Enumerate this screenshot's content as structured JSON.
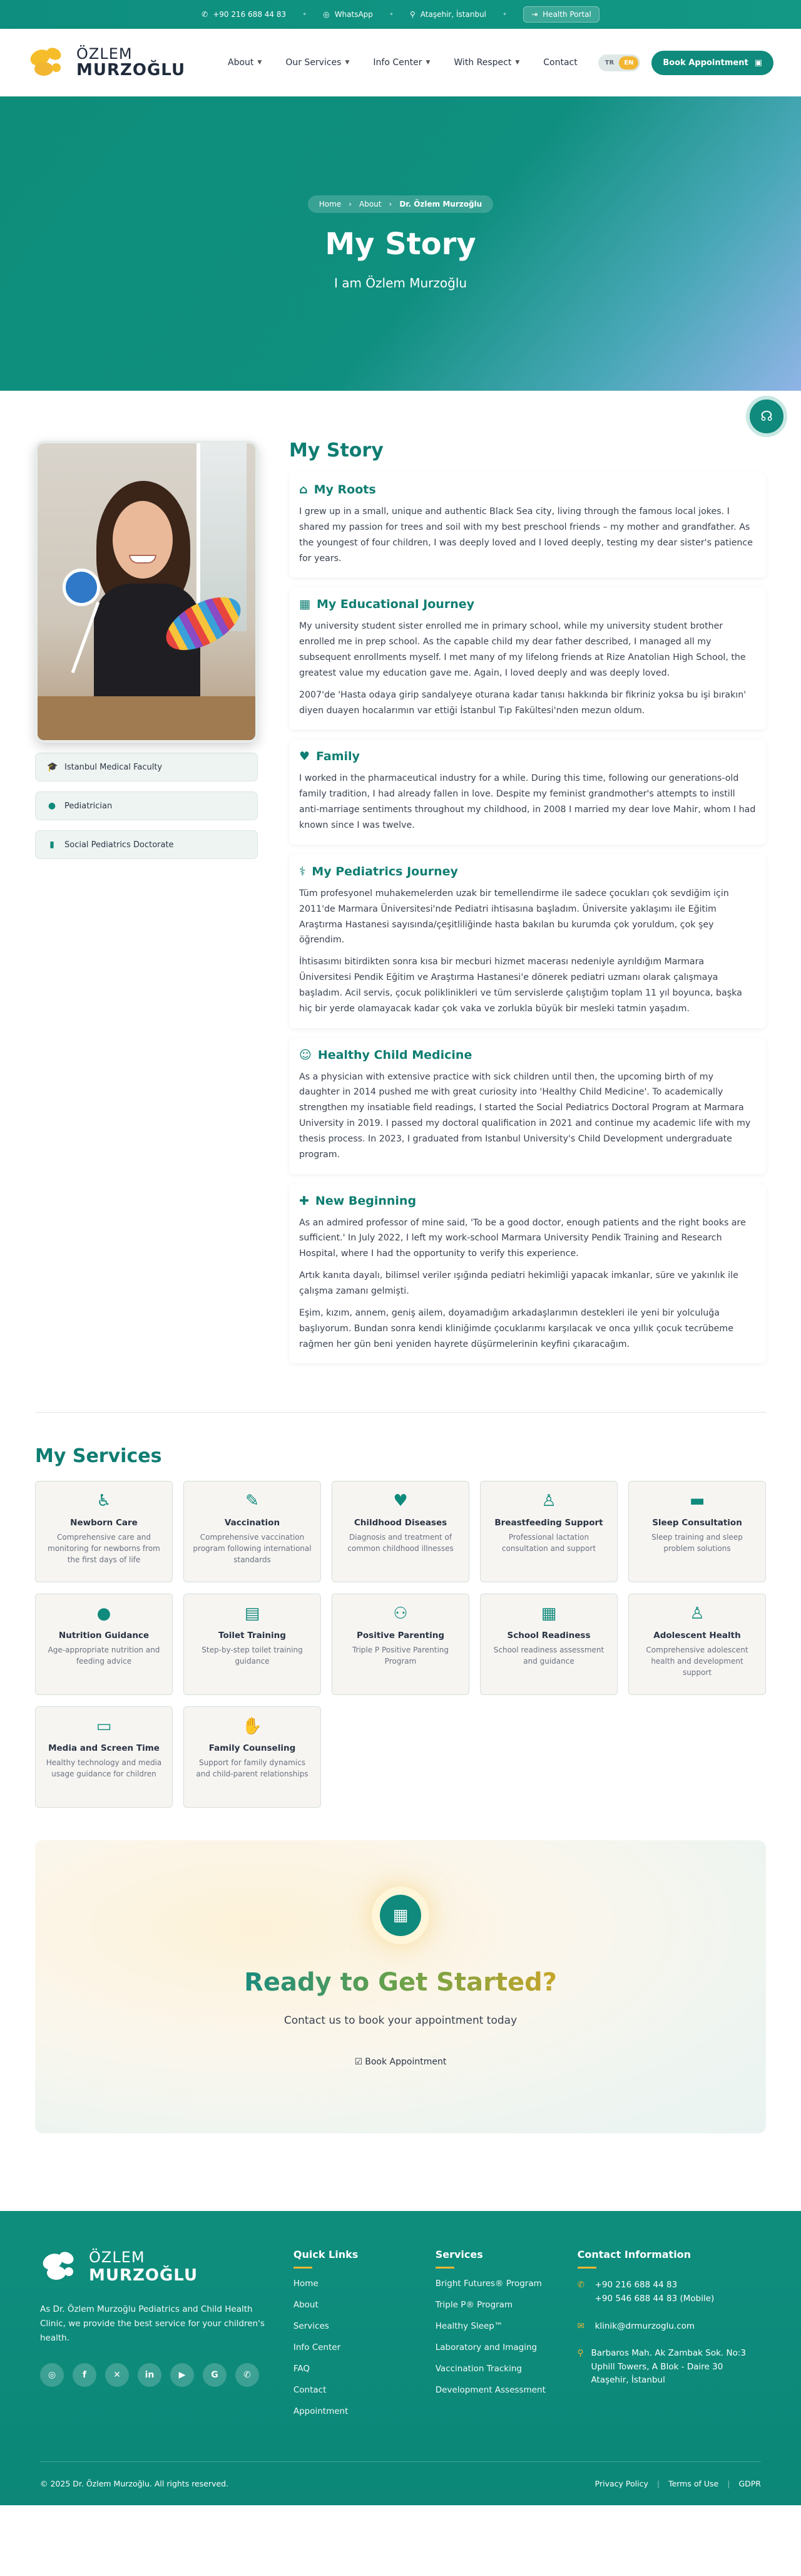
{
  "topbar": {
    "phone": "+90 216 688 44 83",
    "whatsapp": "WhatsApp",
    "location": "Ataşehir, İstanbul",
    "portal": "Health Portal"
  },
  "header": {
    "logo_line1": "ÖZLEM",
    "logo_line2": "MURZOĞLU",
    "nav": [
      {
        "label": "About"
      },
      {
        "label": "Our Services"
      },
      {
        "label": "Info Center"
      },
      {
        "label": "With Respect"
      },
      {
        "label": "Contact"
      }
    ],
    "lang_tr": "TR",
    "lang_en": "EN",
    "book": "Book Appointment"
  },
  "hero": {
    "crumbs": [
      "Home",
      "About",
      "Dr. Özlem Murzoğlu"
    ],
    "title": "My Story",
    "subtitle": "I am Özlem Murzoğlu"
  },
  "tags": [
    {
      "label": "Istanbul Medical Faculty",
      "icon": "graduation-cap-icon"
    },
    {
      "label": "Pediatrician",
      "icon": "circle-icon"
    },
    {
      "label": "Social Pediatrics Doctorate",
      "icon": "book-icon"
    }
  ],
  "story": {
    "title": "My Story",
    "sections": [
      {
        "icon": "house-icon",
        "title": "My Roots",
        "paragraphs": [
          "I grew up in a small, unique and authentic Black Sea city, living through the famous local jokes. I shared my passion for trees and soil with my best preschool friends – my mother and grandfather. As the youngest of four children, I was deeply loved and I loved deeply, testing my dear sister's patience for years."
        ]
      },
      {
        "icon": "school-icon",
        "title": "My Educational Journey",
        "paragraphs": [
          "My university student sister enrolled me in primary school, while my university student brother enrolled me in prep school. As the capable child my dear father described, I managed all my subsequent enrollments myself. I met many of my lifelong friends at Rize Anatolian High School, the greatest value my education gave me. Again, I loved deeply and was deeply loved.",
          "2007'de 'Hasta odaya girip sandalyeye oturana kadar tanısı hakkında bir fikriniz yoksa bu işi bırakın' diyen duayen hocalarımın var ettiği İstanbul Tıp Fakültesi'nden mezun oldum."
        ]
      },
      {
        "icon": "heart-icon",
        "title": "Family",
        "paragraphs": [
          "I worked in the pharmaceutical industry for a while. During this time, following our generations-old family tradition, I had already fallen in love. Despite my feminist grandmother's attempts to instill anti-marriage sentiments throughout my childhood, in 2008 I married my dear love Mahir, whom I had known since I was twelve."
        ]
      },
      {
        "icon": "stethoscope-icon",
        "title": "My Pediatrics Journey",
        "paragraphs": [
          "Tüm profesyonel muhakemelerden uzak bir temellendirme ile sadece çocukları çok sevdiğim için 2011'de Marmara Üniversitesi'nde Pediatri ihtisasına başladım. Üniversite yaklaşımı ile Eğitim Araştırma Hastanesi sayısında/çeşitliliğinde hasta bakılan bu kurumda çok yoruldum, çok şey öğrendim.",
          "İhtisasımı bitirdikten sonra kısa bir mecburi hizmet macerası nedeniyle ayrıldığım Marmara Üniversitesi Pendik Eğitim ve Araştırma Hastanesi'e dönerek pediatri uzmanı olarak çalışmaya başladım. Acil servis, çocuk poliklinikleri ve tüm servislerde çalıştığım toplam 11 yıl boyunca, başka hiç bir yerde olamayacak kadar çok vaka ve zorlukla büyük bir mesleki tatmin yaşadım."
        ]
      },
      {
        "icon": "child-icon",
        "title": "Healthy Child Medicine",
        "paragraphs": [
          "As a physician with extensive practice with sick children until then, the upcoming birth of my daughter in 2014 pushed me with great curiosity into 'Healthy Child Medicine'. To academically strengthen my insatiable field readings, I started the Social Pediatrics Doctoral Program at Marmara University in 2019. I passed my doctoral qualification in 2021 and continue my academic life with my thesis process. In 2023, I graduated from Istanbul University's Child Development undergraduate program."
        ]
      },
      {
        "icon": "clinic-icon",
        "title": "New Beginning",
        "paragraphs": [
          "As an admired professor of mine said, 'To be a good doctor, enough patients and the right books are sufficient.' In July 2022, I left my work-school Marmara University Pendik Training and Research Hospital, where I had the opportunity to verify this experience.",
          "Artık kanıta dayalı, bilimsel veriler ışığında pediatri hekimliği yapacak imkanlar, süre ve yakınlık ile çalışma zamanı gelmişti.",
          "Eşim, kızım, annem, geniş ailem, doyamadığım arkadaşlarımın destekleri ile yeni bir yolculuğa başlıyorum. Bundan sonra kendi kliniğimde çocuklarımı karşılacak ve onca yıllık çocuk tecrübeme rağmen her gün beni yeniden hayrete düşürmelerinin keyfini çıkaracağım."
        ]
      }
    ]
  },
  "services": {
    "title": "My Services",
    "items": [
      {
        "title": "Newborn Care",
        "desc": "Comprehensive care and monitoring for newborns from the first days of life",
        "icon": "baby-carriage-icon"
      },
      {
        "title": "Vaccination",
        "desc": "Comprehensive vaccination program following international standards",
        "icon": "syringe-icon"
      },
      {
        "title": "Childhood Diseases",
        "desc": "Diagnosis and treatment of common childhood illnesses",
        "icon": "heartbeat-icon"
      },
      {
        "title": "Breastfeeding Support",
        "desc": "Professional lactation consultation and support",
        "icon": "person-icon"
      },
      {
        "title": "Sleep Consultation",
        "desc": "Sleep training and sleep problem solutions",
        "icon": "bed-icon"
      },
      {
        "title": "Nutrition Guidance",
        "desc": "Age-appropriate nutrition and feeding advice",
        "icon": "apple-icon"
      },
      {
        "title": "Toilet Training",
        "desc": "Step-by-step toilet training guidance",
        "icon": "toilet-icon"
      },
      {
        "title": "Positive Parenting",
        "desc": "Triple P Positive Parenting Program",
        "icon": "users-icon"
      },
      {
        "title": "School Readiness",
        "desc": "School readiness assessment and guidance",
        "icon": "school-icon"
      },
      {
        "title": "Adolescent Health",
        "desc": "Comprehensive adolescent health and development support",
        "icon": "person-icon"
      },
      {
        "title": "Media and Screen Time",
        "desc": "Healthy technology and media usage guidance for children",
        "icon": "laptop-icon"
      },
      {
        "title": "Family Counseling",
        "desc": "Support for family dynamics and child-parent relationships",
        "icon": "handshake-icon"
      }
    ]
  },
  "cta": {
    "title": "Ready to Get Started?",
    "subtitle": "Contact us to book your appointment today",
    "button": "Book Appointment"
  },
  "footer": {
    "logo_line1": "ÖZLEM",
    "logo_line2": "MURZOĞLU",
    "desc": "As Dr. Özlem Murzoğlu Pediatrics and Child Health Clinic, we provide the best service for your children's health.",
    "socials": [
      "instagram-icon",
      "facebook-icon",
      "x-icon",
      "linkedin-icon",
      "youtube-icon",
      "google-icon",
      "whatsapp-icon"
    ],
    "quick_title": "Quick Links",
    "quick_links": [
      "Home",
      "About",
      "Services",
      "Info Center",
      "FAQ",
      "Contact",
      "Appointment"
    ],
    "services_title": "Services",
    "service_links": [
      "Bright Futures® Program",
      "Triple P® Program",
      "Healthy Sleep™",
      "Laboratory and Imaging",
      "Vaccination Tracking",
      "Development Assessment"
    ],
    "contact_title": "Contact Information",
    "phone1": "+90 216 688 44 83",
    "phone2": "+90 546 688 44 83 (Mobile)",
    "email": "klinik@drmurzoglu.com",
    "address": "Barbaros Mah. Ak Zambak Sok. No:3 Uphill Towers, A Blok - Daire 30 Ataşehir, İstanbul",
    "copyright": "© 2025 Dr. Özlem Murzoğlu. All rights reserved.",
    "legal": [
      "Privacy Policy",
      "Terms of Use",
      "GDPR"
    ]
  },
  "colors": {
    "primary": "#0f8a7c",
    "accent": "#f2b632",
    "heading": "#0f7d72"
  }
}
